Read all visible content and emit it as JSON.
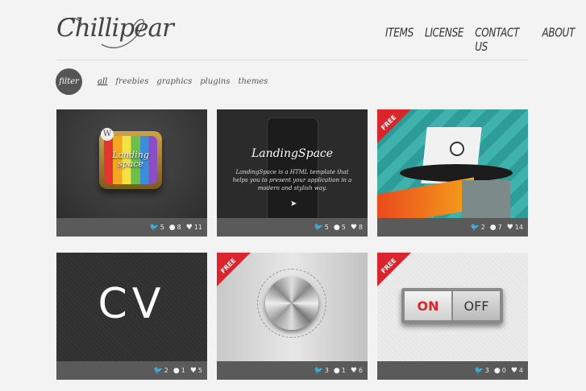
{
  "brand": {
    "logo_text": "Chillipear"
  },
  "nav": {
    "items": [
      "ITEMS",
      "LICENSE",
      "CONTACT US",
      "ABOUT"
    ]
  },
  "filter": {
    "button_label": "filter",
    "tabs": [
      "all",
      "freebies",
      "graphics",
      "plugins",
      "themes"
    ],
    "active": "all"
  },
  "cards": [
    {
      "title": "Landing space",
      "badge": "",
      "stats": {
        "tweets": "5",
        "facebook": "8",
        "likes": "11"
      }
    },
    {
      "title": "LandingSpace",
      "description": "LandingSpace is a HTML template that helps you to present your application in a modern and stylish way.",
      "stats": {
        "tweets": "5",
        "facebook": "5",
        "likes": "8"
      }
    },
    {
      "title": "",
      "badge": "FREE",
      "stats": {
        "tweets": "2",
        "facebook": "7",
        "likes": "14"
      }
    },
    {
      "title": "CV",
      "badge": "",
      "stats": {
        "tweets": "2",
        "facebook": "1",
        "likes": "5"
      }
    },
    {
      "title": "",
      "badge": "FREE",
      "stats": {
        "tweets": "3",
        "facebook": "1",
        "likes": "6"
      }
    },
    {
      "title": "",
      "badge": "FREE",
      "toggle": {
        "on": "ON",
        "off": "OFF"
      },
      "stats": {
        "tweets": "3",
        "facebook": "0",
        "likes": "4"
      }
    }
  ],
  "colors": {
    "accent": "#d9252b",
    "bar": "#5a5a5a",
    "background": "#f3f3f3"
  },
  "icons": [
    "twitter-icon",
    "facebook-icon",
    "heart-icon"
  ]
}
